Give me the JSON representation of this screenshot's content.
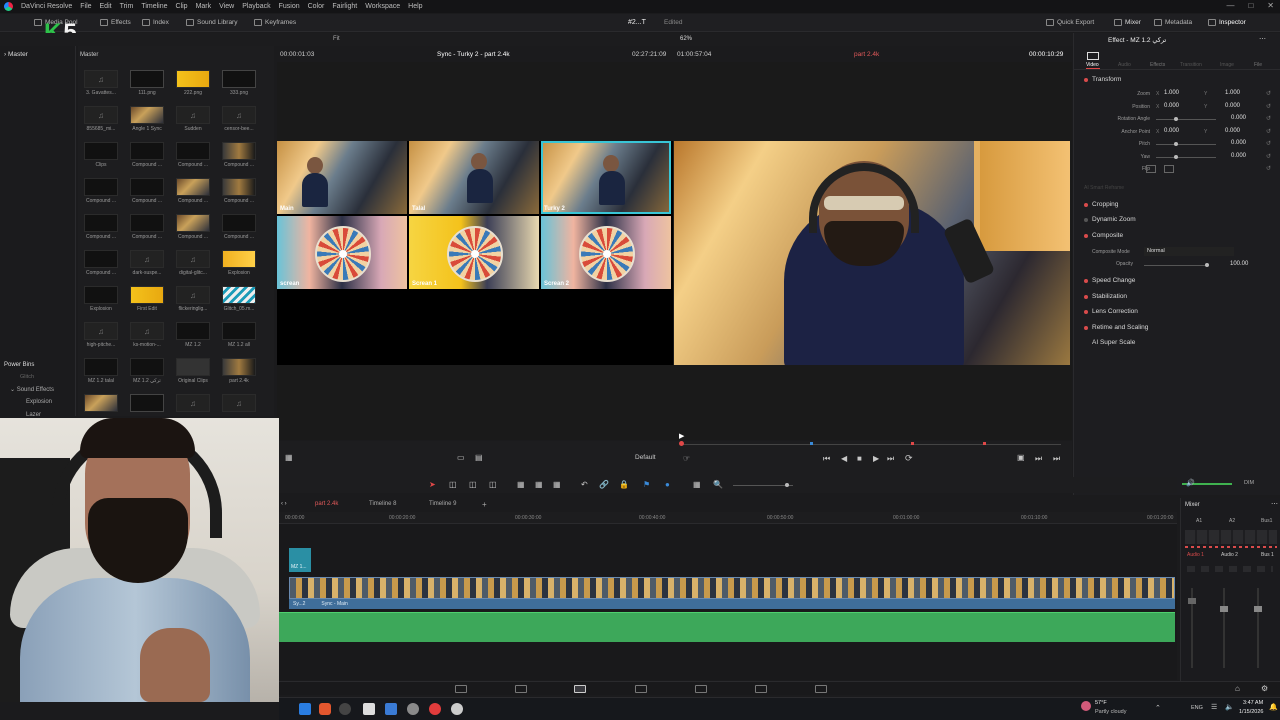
{
  "menubar": {
    "app_name": "DaVinci Resolve",
    "items": [
      "File",
      "Edit",
      "Trim",
      "Timeline",
      "Clip",
      "Mark",
      "View",
      "Playback",
      "Fusion",
      "Color",
      "Fairlight",
      "Workspace",
      "Help"
    ]
  },
  "toolbar": {
    "media_pool": "Media Pool",
    "effects": "Effects",
    "index": "Index",
    "sound_library": "Sound Library",
    "keyframes": "Keyframes",
    "project_title": "#2...T",
    "edited": "Edited",
    "quick_export": "Quick Export",
    "mixer": "Mixer",
    "metadata": "Metadata",
    "inspector": "Inspector"
  },
  "channel_logo": {
    "k": "K",
    "n": "5"
  },
  "subbar": {
    "fit": "Fit",
    "zoom": "62%"
  },
  "bins": {
    "master_left": "Master",
    "master_right": "Master",
    "power_bins": "Power Bins",
    "glitch": "Glitch",
    "sound_effects": "Sound Effects",
    "explosion": "Explosion",
    "lazer": "Lazer"
  },
  "media": [
    {
      "label": "3. Gavattes...",
      "kind": "audio"
    },
    {
      "label": "111.png",
      "kind": "sq"
    },
    {
      "label": "222.png",
      "kind": "yellow"
    },
    {
      "label": "333.png",
      "kind": "sq"
    },
    {
      "label": "855685_mi...",
      "kind": "audio"
    },
    {
      "label": "Angle 1 Sync",
      "kind": "video1"
    },
    {
      "label": "Sudden",
      "kind": "audio"
    },
    {
      "label": "censor-bee...",
      "kind": "audio"
    },
    {
      "label": "Clips",
      "kind": "dark"
    },
    {
      "label": "Compound ...",
      "kind": "dark"
    },
    {
      "label": "Compound ...",
      "kind": "dark"
    },
    {
      "label": "Compound ...",
      "kind": "video2"
    },
    {
      "label": "Compound ...",
      "kind": "dark"
    },
    {
      "label": "Compound ...",
      "kind": "dark"
    },
    {
      "label": "Compound ...",
      "kind": "video1"
    },
    {
      "label": "Compound ...",
      "kind": "video2"
    },
    {
      "label": "Compound ...",
      "kind": "dark"
    },
    {
      "label": "Compound ...",
      "kind": "dark"
    },
    {
      "label": "Compound ...",
      "kind": "video1"
    },
    {
      "label": "Compound ...",
      "kind": "dark"
    },
    {
      "label": "Compound ...",
      "kind": "dark"
    },
    {
      "label": "dark-suspe...",
      "kind": "audio"
    },
    {
      "label": "digital-glitc...",
      "kind": "audio"
    },
    {
      "label": "Explosion",
      "kind": "orange"
    },
    {
      "label": "Explosion",
      "kind": "dark"
    },
    {
      "label": "First Edit",
      "kind": "yellow"
    },
    {
      "label": "flickeringlig...",
      "kind": "audio"
    },
    {
      "label": "Glitch_05.m...",
      "kind": "stripes"
    },
    {
      "label": "high-pitche...",
      "kind": "audio"
    },
    {
      "label": "ks-motion-...",
      "kind": "audio"
    },
    {
      "label": "MZ 1.2",
      "kind": "dark"
    },
    {
      "label": "MZ 1.2 all",
      "kind": "dark"
    },
    {
      "label": "MZ 1.2 talal",
      "kind": "dark"
    },
    {
      "label": "MZ 1.2 تركي",
      "kind": "dark"
    },
    {
      "label": "Original Clips",
      "kind": "folder"
    },
    {
      "label": "part 2.4k",
      "kind": "video2"
    },
    {
      "label": "",
      "kind": "video1"
    },
    {
      "label": "",
      "kind": "sq"
    },
    {
      "label": "",
      "kind": "audio"
    },
    {
      "label": "",
      "kind": "audio"
    }
  ],
  "viewer": {
    "left_timecode": "00:00:01:03",
    "clip_title": "Sync - Turky 2 - part 2.4k",
    "center_timecode": "02:27:21:09",
    "duration": "01:00:57:04",
    "timeline_name": "part 2.4k",
    "right_timecode": "00:00:10:29",
    "cams": [
      "Main",
      "Talal",
      "Turky 2",
      "screan",
      "Screan 1",
      "Screan 2"
    ],
    "default_label": "Default"
  },
  "inspector": {
    "effect_title": "Effect - MZ 1.2 تركي",
    "tabs": [
      "Video",
      "Audio",
      "Effects",
      "Transition",
      "Image",
      "File"
    ],
    "transform": "Transform",
    "params": [
      {
        "name": "Zoom",
        "x": "1.000",
        "y": "1.000"
      },
      {
        "name": "Position",
        "x": "0.000",
        "y": "0.000"
      },
      {
        "name": "Rotation Angle",
        "v": "0.000"
      },
      {
        "name": "Anchor Point",
        "x": "0.000",
        "y": "0.000"
      },
      {
        "name": "Pitch",
        "v": "0.000"
      },
      {
        "name": "Yaw",
        "v": "0.000"
      },
      {
        "name": "Flip",
        "v": ""
      }
    ],
    "ai_smart_reframe": "AI Smart Reframe",
    "sections": [
      "Cropping",
      "Dynamic Zoom",
      "Composite"
    ],
    "composite_mode_label": "Composite Mode",
    "composite_mode": "Normal",
    "opacity_label": "Opacity",
    "opacity": "100.00",
    "sections2": [
      "Speed Change",
      "Stabilization",
      "Lens Correction",
      "Retime and Scaling",
      "AI Super Scale"
    ]
  },
  "timeline": {
    "tabs": [
      "part 2.4k",
      "Timeline 8",
      "Timeline 9"
    ],
    "ruler": [
      "00:00:00",
      "00:00:20:00",
      "00:00:30:00",
      "00:00:40:00",
      "00:00:50:00",
      "00:01:00:00",
      "00:01:10:00",
      "00:01:20:00"
    ],
    "small_clip": "MZ 1...",
    "video_label_a": "Sy...2",
    "video_label_b": "Sync - Main"
  },
  "mixer": {
    "title": "Mixer",
    "dim": "DIM",
    "a1": "A1",
    "a2": "A2",
    "bus1": "Bus1",
    "audio1": "Audio 1",
    "audio2": "Audio 2",
    "bus1b": "Bus 1"
  },
  "taskbar": {
    "temp": "57°F",
    "weather": "Partly cloudy",
    "lang": "ENG",
    "time": "3:47 AM",
    "date": "1/15/2026"
  }
}
